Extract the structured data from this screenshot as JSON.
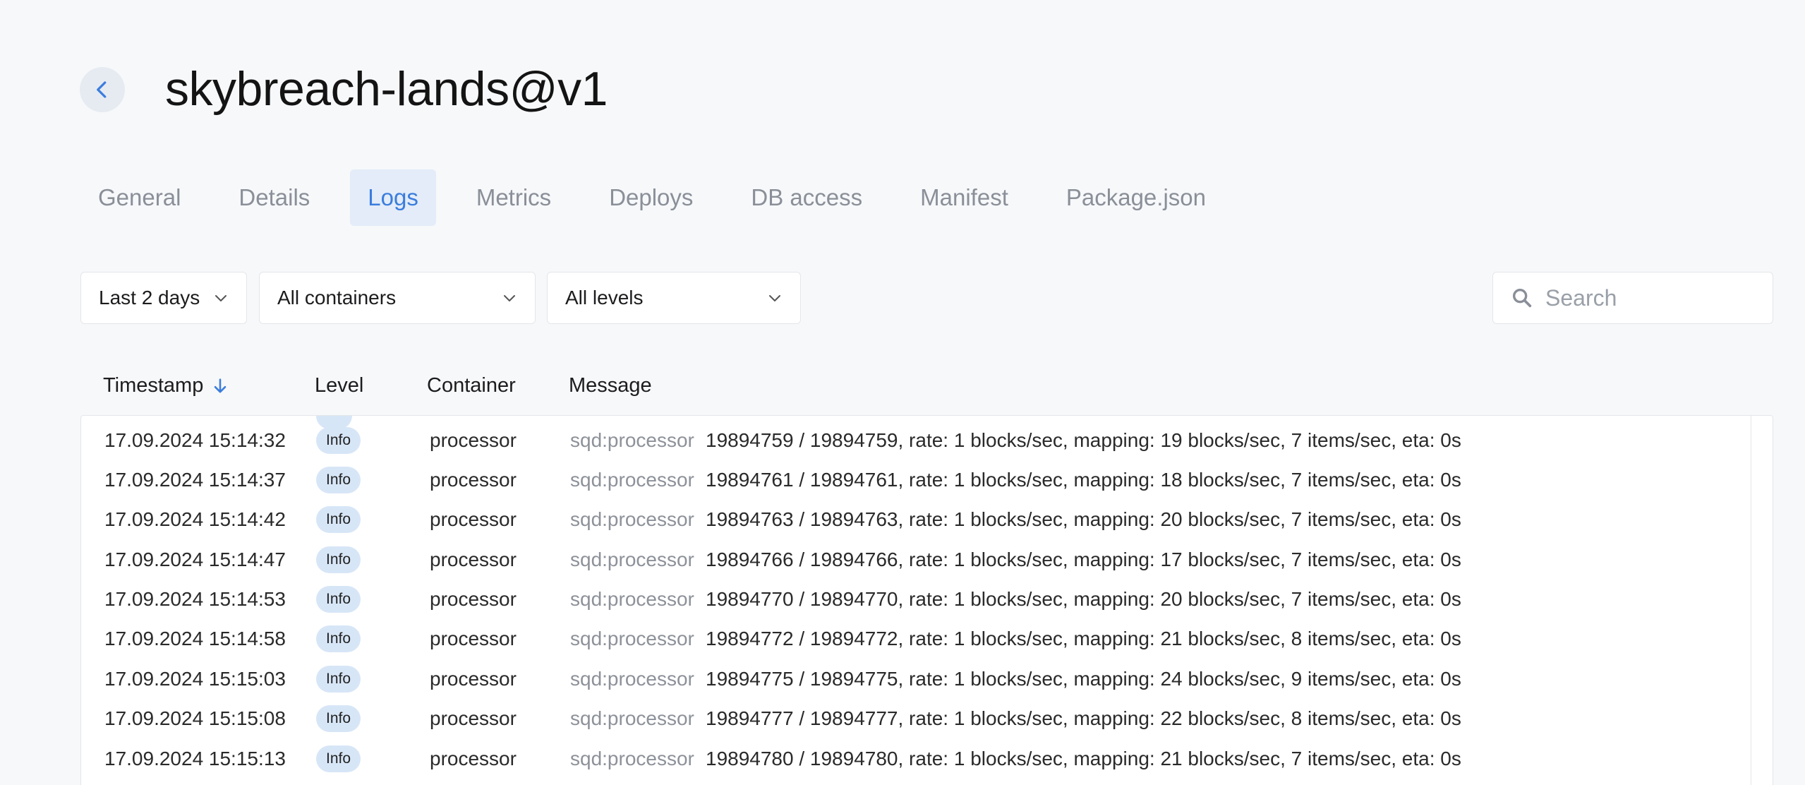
{
  "header": {
    "title": "skybreach-lands@v1"
  },
  "tabs": [
    {
      "label": "General",
      "active": false
    },
    {
      "label": "Details",
      "active": false
    },
    {
      "label": "Logs",
      "active": true
    },
    {
      "label": "Metrics",
      "active": false
    },
    {
      "label": "Deploys",
      "active": false
    },
    {
      "label": "DB access",
      "active": false
    },
    {
      "label": "Manifest",
      "active": false
    },
    {
      "label": "Package.json",
      "active": false
    }
  ],
  "filters": {
    "period": "Last 2 days",
    "containers": "All containers",
    "levels": "All levels",
    "search_placeholder": "Search"
  },
  "table": {
    "columns": {
      "timestamp": "Timestamp",
      "level": "Level",
      "container": "Container",
      "message": "Message"
    },
    "sort_icon": "arrow-down-icon",
    "rows": [
      {
        "timestamp": "17.09.2024 15:14:32",
        "level": "Info",
        "container": "processor",
        "namespace": "sqd:processor",
        "message": "19894759 / 19894759, rate: 1 blocks/sec, mapping: 19 blocks/sec, 7 items/sec, eta: 0s"
      },
      {
        "timestamp": "17.09.2024 15:14:37",
        "level": "Info",
        "container": "processor",
        "namespace": "sqd:processor",
        "message": "19894761 / 19894761, rate: 1 blocks/sec, mapping: 18 blocks/sec, 7 items/sec, eta: 0s"
      },
      {
        "timestamp": "17.09.2024 15:14:42",
        "level": "Info",
        "container": "processor",
        "namespace": "sqd:processor",
        "message": "19894763 / 19894763, rate: 1 blocks/sec, mapping: 20 blocks/sec, 7 items/sec, eta: 0s"
      },
      {
        "timestamp": "17.09.2024 15:14:47",
        "level": "Info",
        "container": "processor",
        "namespace": "sqd:processor",
        "message": "19894766 / 19894766, rate: 1 blocks/sec, mapping: 17 blocks/sec, 7 items/sec, eta: 0s"
      },
      {
        "timestamp": "17.09.2024 15:14:53",
        "level": "Info",
        "container": "processor",
        "namespace": "sqd:processor",
        "message": "19894770 / 19894770, rate: 1 blocks/sec, mapping: 20 blocks/sec, 7 items/sec, eta: 0s"
      },
      {
        "timestamp": "17.09.2024 15:14:58",
        "level": "Info",
        "container": "processor",
        "namespace": "sqd:processor",
        "message": "19894772 / 19894772, rate: 1 blocks/sec, mapping: 21 blocks/sec, 8 items/sec, eta: 0s"
      },
      {
        "timestamp": "17.09.2024 15:15:03",
        "level": "Info",
        "container": "processor",
        "namespace": "sqd:processor",
        "message": "19894775 / 19894775, rate: 1 blocks/sec, mapping: 24 blocks/sec, 9 items/sec, eta: 0s"
      },
      {
        "timestamp": "17.09.2024 15:15:08",
        "level": "Info",
        "container": "processor",
        "namespace": "sqd:processor",
        "message": "19894777 / 19894777, rate: 1 blocks/sec, mapping: 22 blocks/sec, 8 items/sec, eta: 0s"
      },
      {
        "timestamp": "17.09.2024 15:15:13",
        "level": "Info",
        "container": "processor",
        "namespace": "sqd:processor",
        "message": "19894780 / 19894780, rate: 1 blocks/sec, mapping: 21 blocks/sec, 7 items/sec, eta: 0s"
      }
    ]
  },
  "colors": {
    "accent": "#3b7ddd",
    "tab_active_bg": "#e3ecf8",
    "badge_bg": "#d7e6f7",
    "page_bg": "#f7f8fa"
  }
}
